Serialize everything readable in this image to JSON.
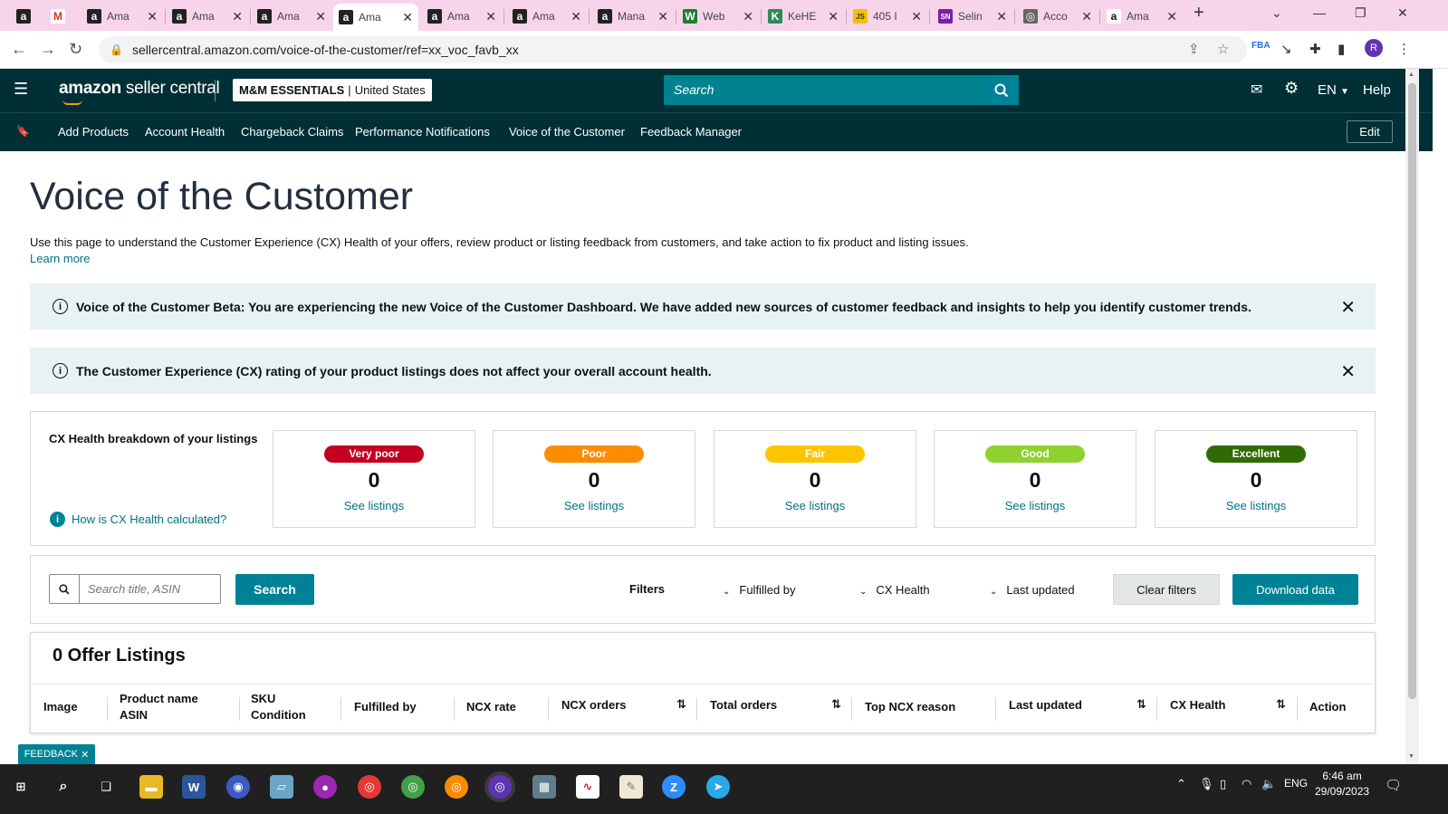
{
  "browser": {
    "tabs": [
      {
        "title": "",
        "favicon": "a"
      },
      {
        "title": "",
        "favicon": "M"
      },
      {
        "title": "Ama",
        "favicon": "a"
      },
      {
        "title": "Ama",
        "favicon": "a"
      },
      {
        "title": "Ama",
        "favicon": "a"
      },
      {
        "title": "Ama",
        "favicon": "a"
      },
      {
        "title": "Ama",
        "favicon": "a"
      },
      {
        "title": "Ama",
        "favicon": "a"
      },
      {
        "title": "Mana",
        "favicon": "a"
      },
      {
        "title": "Web",
        "favicon": "W"
      },
      {
        "title": "KeHE",
        "favicon": "K"
      },
      {
        "title": "405 I",
        "favicon": "JS"
      },
      {
        "title": "Selin",
        "favicon": "SN"
      },
      {
        "title": "Acco",
        "favicon": "◎"
      },
      {
        "title": "Ama",
        "favicon": "a"
      }
    ],
    "new_tab": "+",
    "url": "sellercentral.amazon.com/voice-of-the-customer/ref=xx_voc_favb_xx",
    "profile_initial": "R"
  },
  "header": {
    "logo_amazon": "amazon",
    "logo_rest": " seller central",
    "store_name": "M&M ESSENTIALS",
    "store_sep": "|",
    "store_region": "United States",
    "search_placeholder": "Search",
    "lang": "EN",
    "help": "Help"
  },
  "nav": {
    "items": [
      "Add Products",
      "Account Health",
      "Chargeback Claims",
      "Performance Notifications",
      "Voice of the Customer",
      "Feedback Manager"
    ],
    "edit": "Edit"
  },
  "page": {
    "title": "Voice of the Customer",
    "description": "Use this page to understand the Customer Experience (CX) Health of your offers, review product or listing feedback from customers, and take action to fix product and listing issues.",
    "learn_more": "Learn more"
  },
  "alerts": [
    {
      "text": "Voice of the Customer Beta: You are experiencing the new Voice of the Customer Dashboard. We have added new sources of customer feedback and insights to help you identify customer trends."
    },
    {
      "text": "The Customer Experience (CX) rating of your product listings does not affect your overall account health."
    }
  ],
  "cx_health": {
    "title": "CX Health breakdown of your listings",
    "how_link": "How is CX Health calculated?",
    "categories": [
      {
        "label": "Very poor",
        "count": "0",
        "link": "See listings",
        "color": "#c40022"
      },
      {
        "label": "Poor",
        "count": "0",
        "link": "See listings",
        "color": "#ff8c00"
      },
      {
        "label": "Fair",
        "count": "0",
        "link": "See listings",
        "color": "#ffc400"
      },
      {
        "label": "Good",
        "count": "0",
        "link": "See listings",
        "color": "#8fd12e"
      },
      {
        "label": "Excellent",
        "count": "0",
        "link": "See listings",
        "color": "#2f6b00"
      }
    ]
  },
  "filters": {
    "search_placeholder": "Search title, ASIN",
    "search_button": "Search",
    "label": "Filters",
    "dropdowns": [
      "Fulfilled by",
      "CX Health",
      "Last updated"
    ],
    "clear": "Clear filters",
    "download": "Download data"
  },
  "listings": {
    "title": "0 Offer Listings",
    "columns": {
      "image": "Image",
      "product_name": "Product name",
      "asin": "ASIN",
      "sku": "SKU",
      "condition": "Condition",
      "fulfilled_by": "Fulfilled by",
      "ncx_rate": "NCX rate",
      "ncx_orders": "NCX orders",
      "total_orders": "Total orders",
      "top_ncx_reason": "Top NCX reason",
      "last_updated": "Last updated",
      "cx_health": "CX Health",
      "action": "Action"
    }
  },
  "feedback_tab": {
    "label": "FEEDBACK",
    "close": "✕"
  },
  "taskbar": {
    "time": "6:46 am",
    "date": "29/09/2023",
    "lang": "ENG"
  },
  "colors": {
    "header_bg": "#002f36",
    "accent": "#008296",
    "link": "#007185",
    "alert_bg": "#e6f2f4"
  }
}
